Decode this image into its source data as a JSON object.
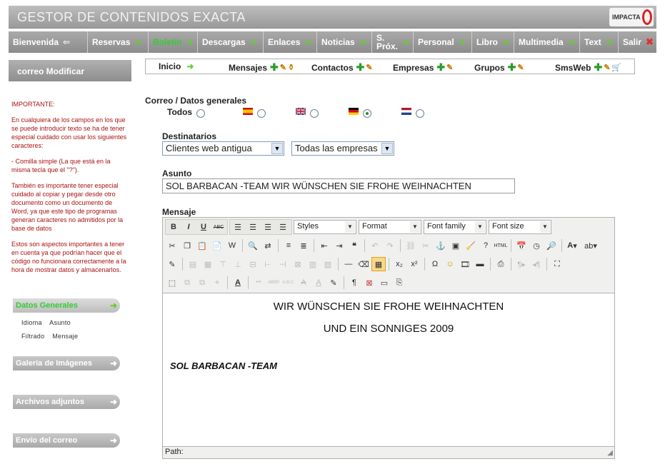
{
  "header": {
    "title": "GESTOR DE CONTENIDOS EXACTA",
    "logo_text": "IMPACTA"
  },
  "menu": [
    {
      "label": "Bienvenida",
      "icon": "back-arrow-icon"
    },
    {
      "label": "Reservas",
      "icon": "go-arrow-icon"
    },
    {
      "label": "Boletín",
      "icon": "go-arrow-icon",
      "active": true
    },
    {
      "label": "Descargas",
      "icon": "go-arrow-icon"
    },
    {
      "label": "Enlaces",
      "icon": "go-arrow-icon"
    },
    {
      "label": "Noticias",
      "icon": "go-arrow-icon"
    },
    {
      "label": "S.",
      "label2": "Próx.",
      "icon": "go-arrow-icon"
    },
    {
      "label": "Personal",
      "icon": "go-arrow-icon"
    },
    {
      "label": "Libro",
      "icon": "go-arrow-icon"
    },
    {
      "label": "Multimedia",
      "icon": "go-arrow-icon"
    },
    {
      "label": "Text",
      "icon": "go-arrow-icon"
    },
    {
      "label": "Salir",
      "icon": "close-icon"
    }
  ],
  "sidebar": {
    "heading": "correo Modificar",
    "info_title": "IMPORTANTE:",
    "info_p1": "En cualquiera de los campos en los que se puede introducir texto se ha de tener especial cuidado con usar los siguientes caracteres:",
    "info_p2": "- Comilla simple (La que está en la misma tecla que el \"?\").",
    "info_p3": "También es importante tener especial cuidado al copiar y pegar desde otro documento como un documento de Word, ya que este tipo de programas generan caracteres no admitidos por la base de datos",
    "info_p4": "Estos son aspectos importantes a tener en cuenta ya que podrían hacer que el código no funcionara correctamente a la hora de mostrar datos y almacenarlos.",
    "buttons": [
      "Datos Generales",
      "Galería de Imágenes",
      "Archivos adjuntos",
      "Envío del correo"
    ],
    "sublinks_row1": [
      "Idioma",
      "Asunto"
    ],
    "sublinks_row2": [
      "Filtrado",
      "Mensaje"
    ]
  },
  "subnav": {
    "inicio": "Inicio",
    "mensajes": "Mensajes",
    "contactos": "Contactos",
    "empresas": "Empresas",
    "grupos": "Grupos",
    "smsweb": "SmsWeb"
  },
  "form": {
    "section_title": "Correo / Datos generales",
    "todos_label": "Todos",
    "languages": [
      {
        "flag": "es-flag-icon",
        "selected": false
      },
      {
        "flag": "uk-flag-icon",
        "selected": false
      },
      {
        "flag": "de-flag-icon",
        "selected": true
      },
      {
        "flag": "nl-flag-icon",
        "selected": false
      }
    ],
    "destinatarios_label": "Destinatarios",
    "destinatarios_value": "Clientes web antigua",
    "empresas_value": "Todas las empresas",
    "asunto_label": "Asunto",
    "asunto_value": "SOL BARBACAN -TEAM WIR WÜNSCHEN SIE FROHE WEIHNACHTEN",
    "mensaje_label": "Mensaje"
  },
  "editor": {
    "styles": "Styles",
    "format": "Format",
    "font_family": "Font family",
    "font_size": "Font size",
    "line1": "WIR WÜNSCHEN SIE FROHE WEIHNACHTEN",
    "line2": "UND EIN SONNIGES 2009",
    "signature": "SOL BARBACAN -TEAM",
    "path_label": "Path:"
  },
  "colors": {
    "accent_green": "#33cc33",
    "warning_red": "#aa1111",
    "menu_gray": "#9a9a9a"
  }
}
